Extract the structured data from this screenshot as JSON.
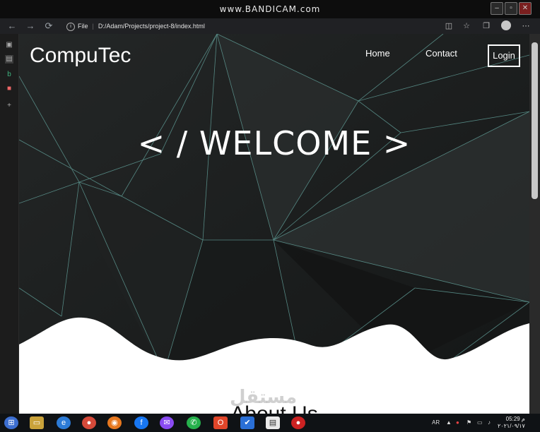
{
  "recorder": {
    "watermark": "www.BANDICAM.com"
  },
  "browser": {
    "url_prefix": "File",
    "url": "D:/Adam/Projects/project-8/index.html"
  },
  "page": {
    "brand": "CompuTec",
    "nav": {
      "home": "Home",
      "contact": "Contact",
      "login": "Login"
    },
    "hero_title": "< / WELCOME >",
    "section_title": "About Us"
  },
  "overlay_watermark": "مستقل",
  "taskbar": {
    "language": "AR",
    "time": "05:29 م",
    "date": "٢٠٢١/٠٩/١٧"
  },
  "colors": {
    "hero_background": "#1b1d1d",
    "mesh_lines": "#5f9a94",
    "wave": "#ffffff"
  }
}
